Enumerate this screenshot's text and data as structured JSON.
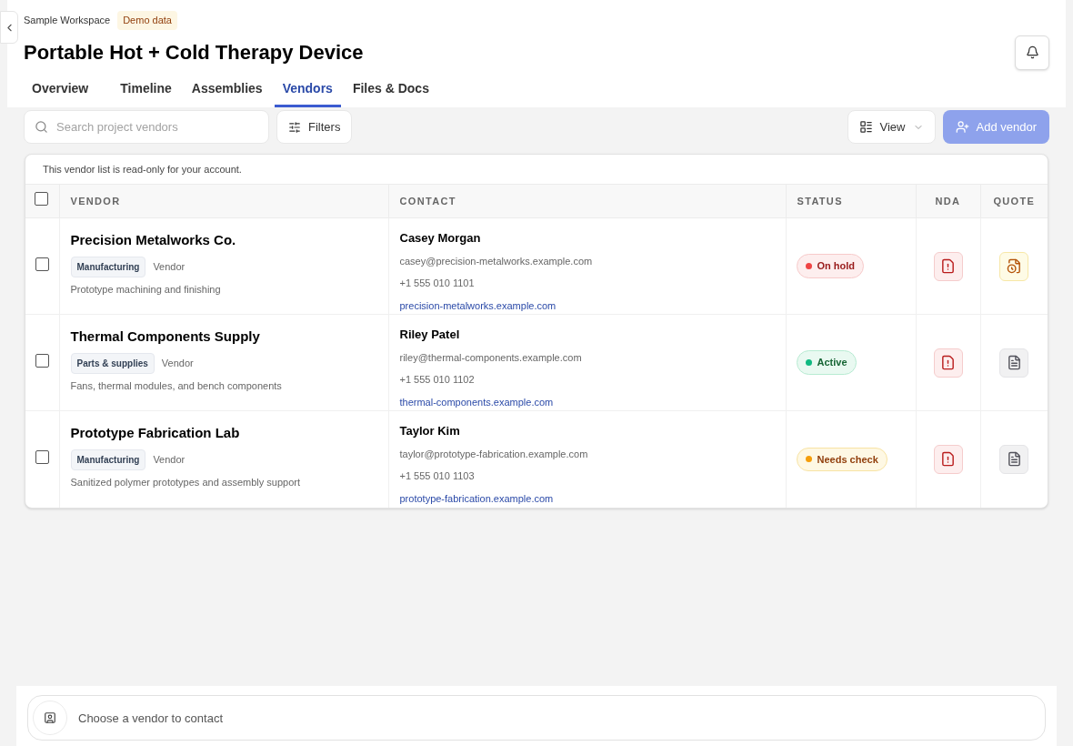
{
  "header": {
    "workspace": "Sample Workspace",
    "badge": "Demo data",
    "title": "Portable Hot + Cold Therapy Device"
  },
  "tabs": [
    {
      "label": "Overview",
      "selected": false
    },
    {
      "label": "Timeline",
      "selected": false
    },
    {
      "label": "Assemblies",
      "selected": false
    },
    {
      "label": "Vendors",
      "selected": true
    },
    {
      "label": "Files & Docs",
      "selected": false
    }
  ],
  "toolbar": {
    "search": {
      "placeholder": "Search project vendors"
    },
    "filters": "Filters",
    "view": "View",
    "add": {
      "label": "Add vendor",
      "disabled": true
    }
  },
  "table": {
    "notice": "This vendor list is read-only for your account.",
    "select_all": {
      "checked": false
    },
    "columns": [
      "VENDOR",
      "CONTACT",
      "STATUS",
      "NDA",
      "QUOTE"
    ],
    "rows": [
      {
        "checked": false,
        "name": "Precision Metalworks Co.",
        "tag": "Manufacturing",
        "role": "Vendor",
        "description": "Prototype machining and finishing",
        "contact": "Casey Morgan",
        "email": "casey@precision-metalworks.example.com",
        "phone": "+1 555 010 1101",
        "website": "precision-metalworks.example.com",
        "status": {
          "label": "On hold",
          "kind": "danger",
          "color": "#ef4444"
        },
        "nda": {
          "kind": "missing"
        },
        "quote": {
          "kind": "pending"
        }
      },
      {
        "checked": false,
        "name": "Thermal Components Supply",
        "tag": "Parts & supplies",
        "role": "Vendor",
        "description": "Fans, thermal modules, and bench components",
        "contact": "Riley Patel",
        "email": "riley@thermal-components.example.com",
        "phone": "+1 555 010 1102",
        "website": "thermal-components.example.com",
        "status": {
          "label": "Active",
          "kind": "success",
          "color": "#10b981"
        },
        "nda": {
          "kind": "missing"
        },
        "quote": {
          "kind": "document"
        }
      },
      {
        "checked": false,
        "name": "Prototype Fabrication Lab",
        "tag": "Manufacturing",
        "role": "Vendor",
        "description": "Sanitized polymer prototypes and assembly support",
        "contact": "Taylor Kim",
        "email": "taylor@prototype-fabrication.example.com",
        "phone": "+1 555 010 1103",
        "website": "prototype-fabrication.example.com",
        "status": {
          "label": "Needs check",
          "kind": "warning",
          "color": "#f59e0b"
        },
        "nda": {
          "kind": "missing"
        },
        "quote": {
          "kind": "document"
        }
      }
    ]
  },
  "contact_bar": {
    "placeholder": "Choose a vendor to contact"
  }
}
